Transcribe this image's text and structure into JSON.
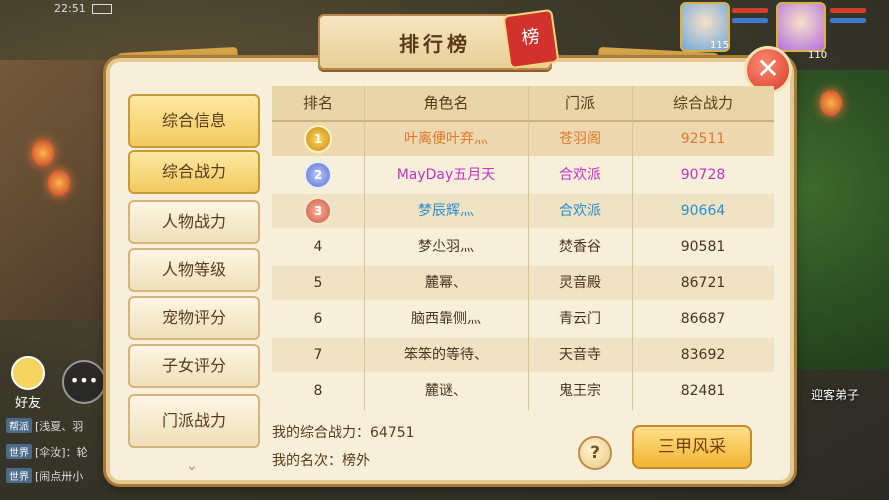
{
  "status": {
    "time": "22:51"
  },
  "title": "排行榜",
  "seal_char": "榜",
  "close_glyph": "✕",
  "sidebar": {
    "items": [
      {
        "label": "综合信息",
        "active": true
      },
      {
        "label": "综合战力",
        "active": true
      },
      {
        "label": "人物战力",
        "active": false
      },
      {
        "label": "人物等级",
        "active": false
      },
      {
        "label": "宠物评分",
        "active": false
      },
      {
        "label": "子女评分",
        "active": false
      },
      {
        "label": "门派战力",
        "active": false
      }
    ]
  },
  "table": {
    "headers": [
      "排名",
      "角色名",
      "门派",
      "综合战力"
    ],
    "rows": [
      {
        "rank": "1",
        "name": "叶离便叶弃灬",
        "sect": "苍羽阁",
        "power": "92511",
        "color": "#e0782a"
      },
      {
        "rank": "2",
        "name": "MayDay五月天",
        "sect": "合欢派",
        "power": "90728",
        "color": "#c632c6"
      },
      {
        "rank": "3",
        "name": "梦辰辉灬",
        "sect": "合欢派",
        "power": "90664",
        "color": "#2a8ed0"
      },
      {
        "rank": "4",
        "name": "梦尐羽灬",
        "sect": "焚香谷",
        "power": "90581",
        "color": "#4a3320"
      },
      {
        "rank": "5",
        "name": "麓幂、",
        "sect": "灵音殿",
        "power": "86721",
        "color": "#4a3320"
      },
      {
        "rank": "6",
        "name": "脑西靠侧灬",
        "sect": "青云门",
        "power": "86687",
        "color": "#4a3320"
      },
      {
        "rank": "7",
        "name": "笨笨的等待、",
        "sect": "天音寺",
        "power": "83692",
        "color": "#4a3320"
      },
      {
        "rank": "8",
        "name": "麓谜、",
        "sect": "鬼王宗",
        "power": "82481",
        "color": "#4a3320"
      }
    ]
  },
  "footer": {
    "my_power": "我的综合战力：64751",
    "my_rank": "我的名次：榜外",
    "help": "?",
    "action": "三甲风采"
  },
  "chat": {
    "friends_label": "好友",
    "chat_glyph": "•••",
    "lines": [
      {
        "tag": "帮派",
        "text": "[浅夏、羽"
      },
      {
        "tag": "世界",
        "text": "[伞汝]：轮"
      },
      {
        "tag": "世界",
        "text": "[闹点卅小"
      }
    ]
  },
  "scene": {
    "disciple_label": "迎客弟子",
    "avatar1_level": "115",
    "avatar2_level": "110"
  }
}
